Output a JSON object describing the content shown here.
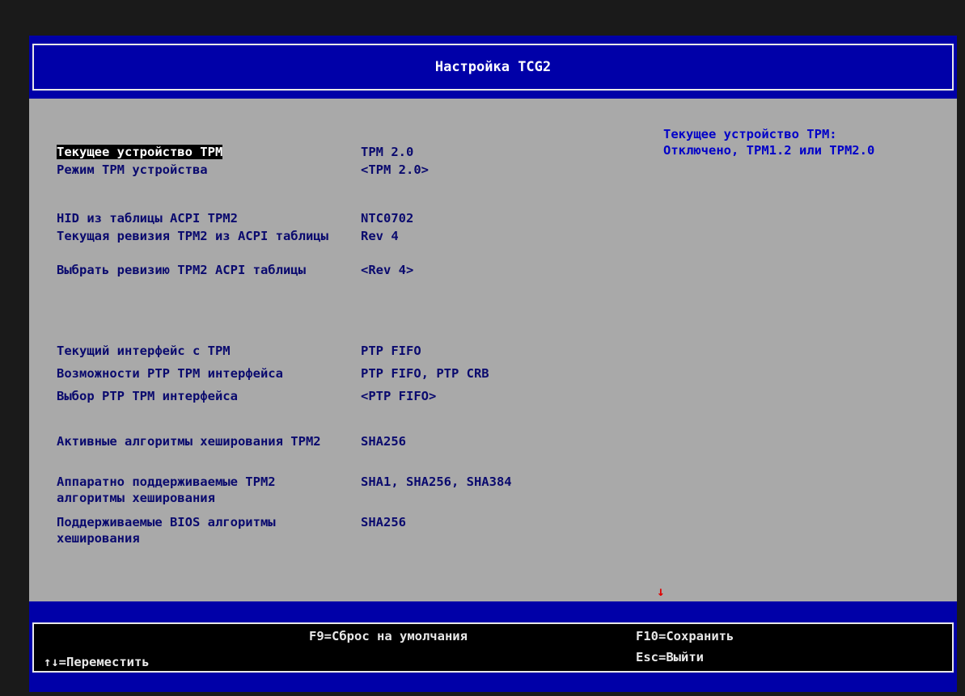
{
  "header": {
    "title": "Настройка TCG2"
  },
  "settings": [
    {
      "label": "Текущее устройство TPM",
      "value": "TPM 2.0"
    },
    {
      "label": "Режим TPM устройства",
      "value": "<TPM 2.0>"
    },
    {
      "label": "HID из таблицы ACPI TPM2",
      "value": "NTC0702"
    },
    {
      "label": "Текущая ревизия TPM2 из ACPI таблицы",
      "value": "Rev 4"
    },
    {
      "label": "Выбрать ревизию TPM2 ACPI таблицы",
      "value": "<Rev 4>"
    },
    {
      "label": "Текущий интерфейс с TPM",
      "value": "PTP FIFO"
    },
    {
      "label": "Возможности PTP TPM интерфейса",
      "value": "PTP FIFO, PTP CRB"
    },
    {
      "label": "Выбор PTP TPM интерфейса",
      "value": "<PTP FIFO>"
    },
    {
      "label": "Активные алгоритмы хеширования TPM2",
      "value": "SHA256"
    },
    {
      "label": "Аппаратно поддерживаемые TPM2 алгоритмы хеширования",
      "value": "SHA1, SHA256, SHA384"
    },
    {
      "label": "Поддерживаемые BIOS алгоритмы хеширования",
      "value": "SHA256"
    }
  ],
  "help": {
    "line1": "Текущее устройство TPM:",
    "line2": "Отключено, TPM1.2 или TPM2.0"
  },
  "scroll_indicator": "↓",
  "footer": {
    "move": "↑↓=Переместить",
    "defaults": "F9=Сброс на умолчания",
    "save": "F10=Сохранить",
    "exit": "Esc=Выйти"
  },
  "colors": {
    "header_bg": "#0000a8",
    "panel_bg": "#a9a9a9",
    "text": "#0a0a6e",
    "help_text": "#0000c8",
    "selection_bg": "#000000",
    "scroll_arrow": "#e00000"
  }
}
